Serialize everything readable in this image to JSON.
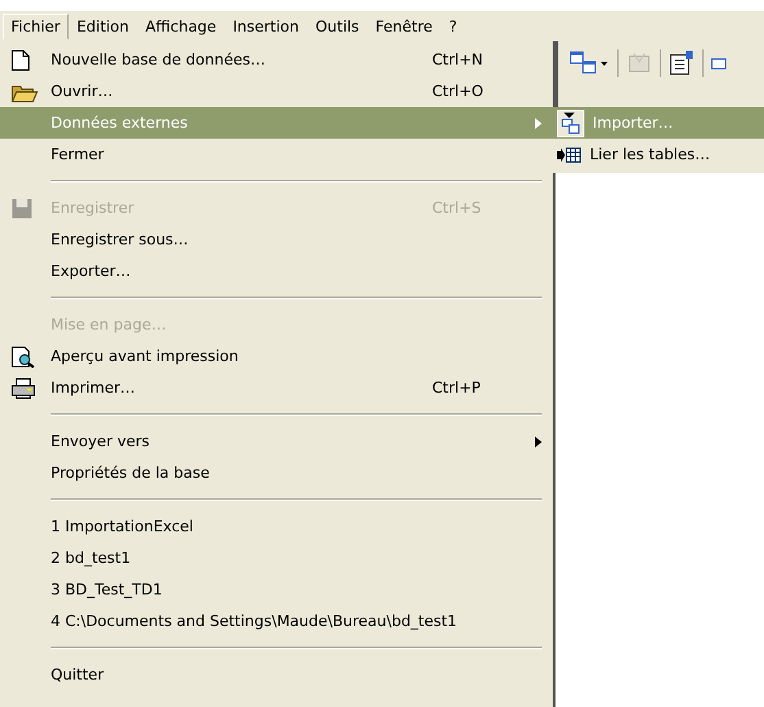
{
  "menu_bar": [
    {
      "label": "Fichier",
      "selected": true
    },
    {
      "label": "Edition",
      "selected": false
    },
    {
      "label": "Affichage",
      "selected": false
    },
    {
      "label": "Insertion",
      "selected": false
    },
    {
      "label": "Outils",
      "selected": false
    },
    {
      "label": "Fenêtre",
      "selected": false
    },
    {
      "label": "?",
      "selected": false
    }
  ],
  "menu": {
    "items": [
      {
        "kind": "item",
        "label": "Nouvelle base de données…",
        "shortcut": "Ctrl+N",
        "disabled": false,
        "selected": false,
        "submenu": false
      },
      {
        "kind": "item",
        "label": "Ouvrir…",
        "shortcut": "Ctrl+O",
        "disabled": false,
        "selected": false,
        "submenu": false
      },
      {
        "kind": "item",
        "label": "Données externes",
        "disabled": false,
        "selected": true,
        "submenu": true
      },
      {
        "kind": "item",
        "label": "Fermer",
        "disabled": false,
        "selected": false,
        "submenu": false
      },
      {
        "kind": "separator"
      },
      {
        "kind": "item",
        "label": "Enregistrer",
        "shortcut": "Ctrl+S",
        "disabled": true,
        "selected": false,
        "submenu": false
      },
      {
        "kind": "item",
        "label": "Enregistrer sous…",
        "disabled": false,
        "selected": false,
        "submenu": false
      },
      {
        "kind": "item",
        "label": "Exporter…",
        "disabled": false,
        "selected": false,
        "submenu": false
      },
      {
        "kind": "separator"
      },
      {
        "kind": "item",
        "label": "Mise en page…",
        "disabled": true,
        "selected": false,
        "submenu": false
      },
      {
        "kind": "item",
        "label": "Aperçu avant impression",
        "disabled": false,
        "selected": false,
        "submenu": false
      },
      {
        "kind": "item",
        "label": "Imprimer…",
        "shortcut": "Ctrl+P",
        "disabled": false,
        "selected": false,
        "submenu": false
      },
      {
        "kind": "separator"
      },
      {
        "kind": "item",
        "label": "Envoyer vers",
        "disabled": false,
        "selected": false,
        "submenu": true
      },
      {
        "kind": "item",
        "label": "Propriétés de la base",
        "disabled": false,
        "selected": false,
        "submenu": false
      },
      {
        "kind": "separator"
      },
      {
        "kind": "item",
        "label": "1 ImportationExcel",
        "disabled": false,
        "selected": false,
        "submenu": false
      },
      {
        "kind": "item",
        "label": "2 bd_test1",
        "disabled": false,
        "selected": false,
        "submenu": false
      },
      {
        "kind": "item",
        "label": "3 BD_Test_TD1",
        "disabled": false,
        "selected": false,
        "submenu": false
      },
      {
        "kind": "item",
        "label": "4 C:\\Documents and Settings\\Maude\\Bureau\\bd_test1",
        "disabled": false,
        "selected": false,
        "submenu": false
      },
      {
        "kind": "separator"
      },
      {
        "kind": "item",
        "label": "Quitter",
        "disabled": false,
        "selected": false,
        "submenu": false
      }
    ]
  },
  "submenu": {
    "items": [
      {
        "label": "Importer…",
        "selected": true
      },
      {
        "label": "Lier les tables…",
        "selected": false
      }
    ]
  }
}
